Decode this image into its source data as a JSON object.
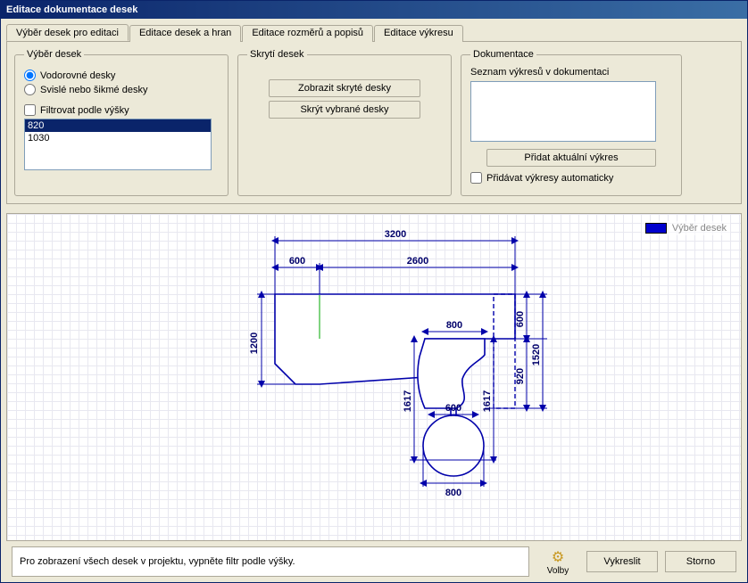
{
  "window": {
    "title": "Editace dokumentace desek"
  },
  "tabs": [
    {
      "label": "Výběr desek pro editaci",
      "active": true
    },
    {
      "label": "Editace desek a hran",
      "active": false
    },
    {
      "label": "Editace rozměrů a popisů",
      "active": false
    },
    {
      "label": "Editace výkresu",
      "active": false
    }
  ],
  "panel_select": {
    "legend": "Výběr desek",
    "radio1": "Vodorovné desky",
    "radio2": "Svislé nebo šikmé desky",
    "filter_label": "Filtrovat podle výšky",
    "heights": [
      {
        "value": "820",
        "selected": true
      },
      {
        "value": "1030",
        "selected": false
      }
    ]
  },
  "panel_hide": {
    "legend": "Skrytí desek",
    "btn_show": "Zobrazit skryté desky",
    "btn_hide": "Skrýt vybrané desky"
  },
  "panel_doc": {
    "legend": "Dokumentace",
    "list_label": "Seznam výkresů v dokumentaci",
    "btn_add": "Přidat aktuální výkres",
    "chk_auto": "Přidávat výkresy automaticky"
  },
  "drawing_legend": "Výběr desek",
  "dims": {
    "top_total": "3200",
    "top_left": "600",
    "top_right": "2600",
    "left_h": "1200",
    "mid_800": "800",
    "right_600": "600",
    "right_920": "920",
    "right_1520": "1520",
    "mid_1617_l": "1617",
    "mid_1617_r": "1617",
    "circle_w": "600",
    "bot_800": "800"
  },
  "hint": "Pro zobrazení všech desek v projektu, vypněte filtr podle výšky.",
  "footer": {
    "options": "Volby",
    "render": "Vykreslit",
    "cancel": "Storno"
  }
}
